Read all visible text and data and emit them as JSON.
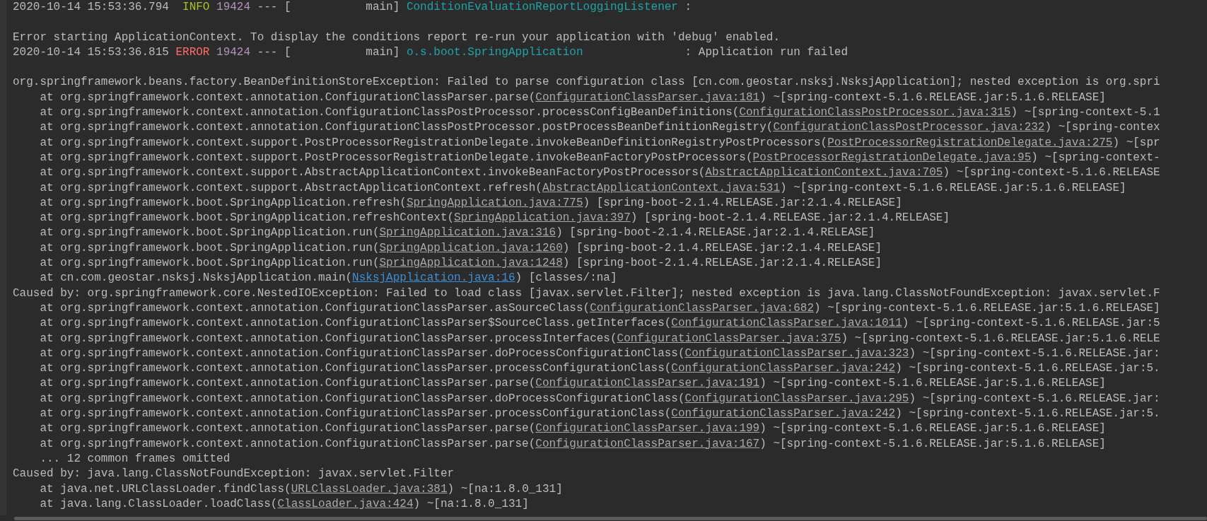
{
  "console": {
    "lines": [
      {
        "kind": "log",
        "parts": [
          {
            "kind": "text",
            "text": "2020-10-14 15:53:36.794  "
          },
          {
            "kind": "info",
            "text": "INFO"
          },
          {
            "kind": "pid",
            "text": "19424"
          },
          {
            "kind": "text",
            "text": " --- [           main] "
          },
          {
            "kind": "logger",
            "text": "ConditionEvaluationReportLoggingListener"
          },
          {
            "kind": "text",
            "text": " :"
          }
        ]
      },
      {
        "kind": "blank"
      },
      {
        "kind": "log",
        "parts": [
          {
            "kind": "text",
            "text": "Error starting ApplicationContext. To display the conditions report re-run your application with 'debug' enabled."
          }
        ]
      },
      {
        "kind": "log",
        "parts": [
          {
            "kind": "text",
            "text": "2020-10-14 15:53:36.815 "
          },
          {
            "kind": "error",
            "text": "ERROR"
          },
          {
            "kind": "pid",
            "text": "19424"
          },
          {
            "kind": "text",
            "text": " --- [           main] "
          },
          {
            "kind": "logger",
            "text": "o.s.boot.SpringApplication"
          },
          {
            "kind": "text",
            "text": "               : Application run failed"
          }
        ]
      },
      {
        "kind": "blank"
      },
      {
        "kind": "log",
        "parts": [
          {
            "kind": "text",
            "text": "org.springframework.beans.factory.BeanDefinitionStoreException: Failed to parse configuration class [cn.com.geostar.nsksj.NsksjApplication]; nested exception is org.spri"
          }
        ]
      },
      {
        "kind": "frame",
        "parts": [
          {
            "kind": "text",
            "text": "at org.springframework.context.annotation.ConfigurationClassParser.parse("
          },
          {
            "kind": "link",
            "text": "ConfigurationClassParser.java:181"
          },
          {
            "kind": "text",
            "text": ") ~[spring-context-5.1.6.RELEASE.jar:5.1.6.RELEASE]"
          }
        ]
      },
      {
        "kind": "frame",
        "parts": [
          {
            "kind": "text",
            "text": "at org.springframework.context.annotation.ConfigurationClassPostProcessor.processConfigBeanDefinitions("
          },
          {
            "kind": "link",
            "text": "ConfigurationClassPostProcessor.java:315"
          },
          {
            "kind": "text",
            "text": ") ~[spring-context-5.1"
          }
        ]
      },
      {
        "kind": "frame",
        "parts": [
          {
            "kind": "text",
            "text": "at org.springframework.context.annotation.ConfigurationClassPostProcessor.postProcessBeanDefinitionRegistry("
          },
          {
            "kind": "link",
            "text": "ConfigurationClassPostProcessor.java:232"
          },
          {
            "kind": "text",
            "text": ") ~[spring-contex"
          }
        ]
      },
      {
        "kind": "frame",
        "parts": [
          {
            "kind": "text",
            "text": "at org.springframework.context.support.PostProcessorRegistrationDelegate.invokeBeanDefinitionRegistryPostProcessors("
          },
          {
            "kind": "link",
            "text": "PostProcessorRegistrationDelegate.java:275"
          },
          {
            "kind": "text",
            "text": ") ~[spr"
          }
        ]
      },
      {
        "kind": "frame",
        "parts": [
          {
            "kind": "text",
            "text": "at org.springframework.context.support.PostProcessorRegistrationDelegate.invokeBeanFactoryPostProcessors("
          },
          {
            "kind": "link",
            "text": "PostProcessorRegistrationDelegate.java:95"
          },
          {
            "kind": "text",
            "text": ") ~[spring-context-"
          }
        ]
      },
      {
        "kind": "frame",
        "parts": [
          {
            "kind": "text",
            "text": "at org.springframework.context.support.AbstractApplicationContext.invokeBeanFactoryPostProcessors("
          },
          {
            "kind": "link",
            "text": "AbstractApplicationContext.java:705"
          },
          {
            "kind": "text",
            "text": ") ~[spring-context-5.1.6.RELEASE"
          }
        ]
      },
      {
        "kind": "frame",
        "parts": [
          {
            "kind": "text",
            "text": "at org.springframework.context.support.AbstractApplicationContext.refresh("
          },
          {
            "kind": "link",
            "text": "AbstractApplicationContext.java:531"
          },
          {
            "kind": "text",
            "text": ") ~[spring-context-5.1.6.RELEASE.jar:5.1.6.RELEASE]"
          }
        ]
      },
      {
        "kind": "frame",
        "parts": [
          {
            "kind": "text",
            "text": "at org.springframework.boot.SpringApplication.refresh("
          },
          {
            "kind": "link",
            "text": "SpringApplication.java:775"
          },
          {
            "kind": "text",
            "text": ") [spring-boot-2.1.4.RELEASE.jar:2.1.4.RELEASE]"
          }
        ]
      },
      {
        "kind": "frame",
        "parts": [
          {
            "kind": "text",
            "text": "at org.springframework.boot.SpringApplication.refreshContext("
          },
          {
            "kind": "link",
            "text": "SpringApplication.java:397"
          },
          {
            "kind": "text",
            "text": ") [spring-boot-2.1.4.RELEASE.jar:2.1.4.RELEASE]"
          }
        ]
      },
      {
        "kind": "frame",
        "parts": [
          {
            "kind": "text",
            "text": "at org.springframework.boot.SpringApplication.run("
          },
          {
            "kind": "link",
            "text": "SpringApplication.java:316"
          },
          {
            "kind": "text",
            "text": ") [spring-boot-2.1.4.RELEASE.jar:2.1.4.RELEASE]"
          }
        ]
      },
      {
        "kind": "frame",
        "parts": [
          {
            "kind": "text",
            "text": "at org.springframework.boot.SpringApplication.run("
          },
          {
            "kind": "link",
            "text": "SpringApplication.java:1260"
          },
          {
            "kind": "text",
            "text": ") [spring-boot-2.1.4.RELEASE.jar:2.1.4.RELEASE]"
          }
        ]
      },
      {
        "kind": "frame",
        "parts": [
          {
            "kind": "text",
            "text": "at org.springframework.boot.SpringApplication.run("
          },
          {
            "kind": "link",
            "text": "SpringApplication.java:1248"
          },
          {
            "kind": "text",
            "text": ") [spring-boot-2.1.4.RELEASE.jar:2.1.4.RELEASE]"
          }
        ]
      },
      {
        "kind": "frame",
        "parts": [
          {
            "kind": "text",
            "text": "at cn.com.geostar.nsksj.NsksjApplication.main("
          },
          {
            "kind": "project-link",
            "text": "NsksjApplication.java:16"
          },
          {
            "kind": "text",
            "text": ") [classes/:na]"
          }
        ]
      },
      {
        "kind": "log",
        "parts": [
          {
            "kind": "text",
            "text": "Caused by: org.springframework.core.NestedIOException: Failed to load class [javax.servlet.Filter]; nested exception is java.lang.ClassNotFoundException: javax.servlet.F"
          }
        ]
      },
      {
        "kind": "frame",
        "parts": [
          {
            "kind": "text",
            "text": "at org.springframework.context.annotation.ConfigurationClassParser.asSourceClass("
          },
          {
            "kind": "link",
            "text": "ConfigurationClassParser.java:682"
          },
          {
            "kind": "text",
            "text": ") ~[spring-context-5.1.6.RELEASE.jar:5.1.6.RELEASE]"
          }
        ]
      },
      {
        "kind": "frame",
        "parts": [
          {
            "kind": "text",
            "text": "at org.springframework.context.annotation.ConfigurationClassParser$SourceClass.getInterfaces("
          },
          {
            "kind": "link",
            "text": "ConfigurationClassParser.java:1011"
          },
          {
            "kind": "text",
            "text": ") ~[spring-context-5.1.6.RELEASE.jar:5"
          }
        ]
      },
      {
        "kind": "frame",
        "parts": [
          {
            "kind": "text",
            "text": "at org.springframework.context.annotation.ConfigurationClassParser.processInterfaces("
          },
          {
            "kind": "link",
            "text": "ConfigurationClassParser.java:375"
          },
          {
            "kind": "text",
            "text": ") ~[spring-context-5.1.6.RELEASE.jar:5.1.6.RELE"
          }
        ]
      },
      {
        "kind": "frame",
        "parts": [
          {
            "kind": "text",
            "text": "at org.springframework.context.annotation.ConfigurationClassParser.doProcessConfigurationClass("
          },
          {
            "kind": "link",
            "text": "ConfigurationClassParser.java:323"
          },
          {
            "kind": "text",
            "text": ") ~[spring-context-5.1.6.RELEASE.jar:"
          }
        ]
      },
      {
        "kind": "frame",
        "parts": [
          {
            "kind": "text",
            "text": "at org.springframework.context.annotation.ConfigurationClassParser.processConfigurationClass("
          },
          {
            "kind": "link",
            "text": "ConfigurationClassParser.java:242"
          },
          {
            "kind": "text",
            "text": ") ~[spring-context-5.1.6.RELEASE.jar:5."
          }
        ]
      },
      {
        "kind": "frame",
        "parts": [
          {
            "kind": "text",
            "text": "at org.springframework.context.annotation.ConfigurationClassParser.parse("
          },
          {
            "kind": "link",
            "text": "ConfigurationClassParser.java:191"
          },
          {
            "kind": "text",
            "text": ") ~[spring-context-5.1.6.RELEASE.jar:5.1.6.RELEASE]"
          }
        ]
      },
      {
        "kind": "frame",
        "parts": [
          {
            "kind": "text",
            "text": "at org.springframework.context.annotation.ConfigurationClassParser.doProcessConfigurationClass("
          },
          {
            "kind": "link",
            "text": "ConfigurationClassParser.java:295"
          },
          {
            "kind": "text",
            "text": ") ~[spring-context-5.1.6.RELEASE.jar:"
          }
        ]
      },
      {
        "kind": "frame",
        "parts": [
          {
            "kind": "text",
            "text": "at org.springframework.context.annotation.ConfigurationClassParser.processConfigurationClass("
          },
          {
            "kind": "link",
            "text": "ConfigurationClassParser.java:242"
          },
          {
            "kind": "text",
            "text": ") ~[spring-context-5.1.6.RELEASE.jar:5."
          }
        ]
      },
      {
        "kind": "frame",
        "parts": [
          {
            "kind": "text",
            "text": "at org.springframework.context.annotation.ConfigurationClassParser.parse("
          },
          {
            "kind": "link",
            "text": "ConfigurationClassParser.java:199"
          },
          {
            "kind": "text",
            "text": ") ~[spring-context-5.1.6.RELEASE.jar:5.1.6.RELEASE]"
          }
        ]
      },
      {
        "kind": "frame",
        "parts": [
          {
            "kind": "text",
            "text": "at org.springframework.context.annotation.ConfigurationClassParser.parse("
          },
          {
            "kind": "link",
            "text": "ConfigurationClassParser.java:167"
          },
          {
            "kind": "text",
            "text": ") ~[spring-context-5.1.6.RELEASE.jar:5.1.6.RELEASE]"
          }
        ]
      },
      {
        "kind": "frame",
        "parts": [
          {
            "kind": "text",
            "text": "... 12 common frames omitted"
          }
        ]
      },
      {
        "kind": "log",
        "parts": [
          {
            "kind": "text",
            "text": "Caused by: java.lang.ClassNotFoundException: javax.servlet.Filter"
          }
        ]
      },
      {
        "kind": "frame",
        "parts": [
          {
            "kind": "text",
            "text": "at java.net.URLClassLoader.findClass("
          },
          {
            "kind": "link",
            "text": "URLClassLoader.java:381"
          },
          {
            "kind": "text",
            "text": ") ~[na:1.8.0_131]"
          }
        ]
      },
      {
        "kind": "frame",
        "parts": [
          {
            "kind": "text",
            "text": "at java.lang.ClassLoader.loadClass("
          },
          {
            "kind": "link",
            "text": "ClassLoader.java:424"
          },
          {
            "kind": "text",
            "text": ") ~[na:1.8.0_131]"
          }
        ]
      }
    ]
  }
}
